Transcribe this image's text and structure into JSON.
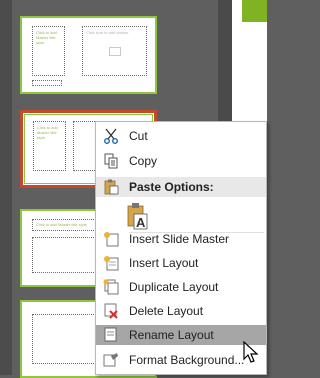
{
  "thumbnails": [
    {
      "title_text": "Click to add\nMaster title style",
      "content_text": "Click icon to add picture",
      "selected": false
    },
    {
      "title_text": "Click to add\nMaster title style",
      "content_text": "",
      "selected": true
    },
    {
      "title_text": "Click to add Master title style",
      "content_text": "",
      "selected": false
    },
    {
      "title_text": "",
      "content_text": "",
      "selected": false
    }
  ],
  "context_menu": {
    "cut": "Cut",
    "copy": "Copy",
    "paste_options": "Paste Options:",
    "insert_slide_master": "Insert Slide Master",
    "insert_layout": "Insert Layout",
    "duplicate_layout": "Duplicate Layout",
    "delete_layout": "Delete Layout",
    "rename_layout": "Rename Layout",
    "format_background": "Format Background..."
  },
  "hovered_item": "rename_layout",
  "colors": {
    "accent_green": "#8dc63f",
    "selection_red": "#c44a2b",
    "hover_gray": "#a6a6a6"
  }
}
